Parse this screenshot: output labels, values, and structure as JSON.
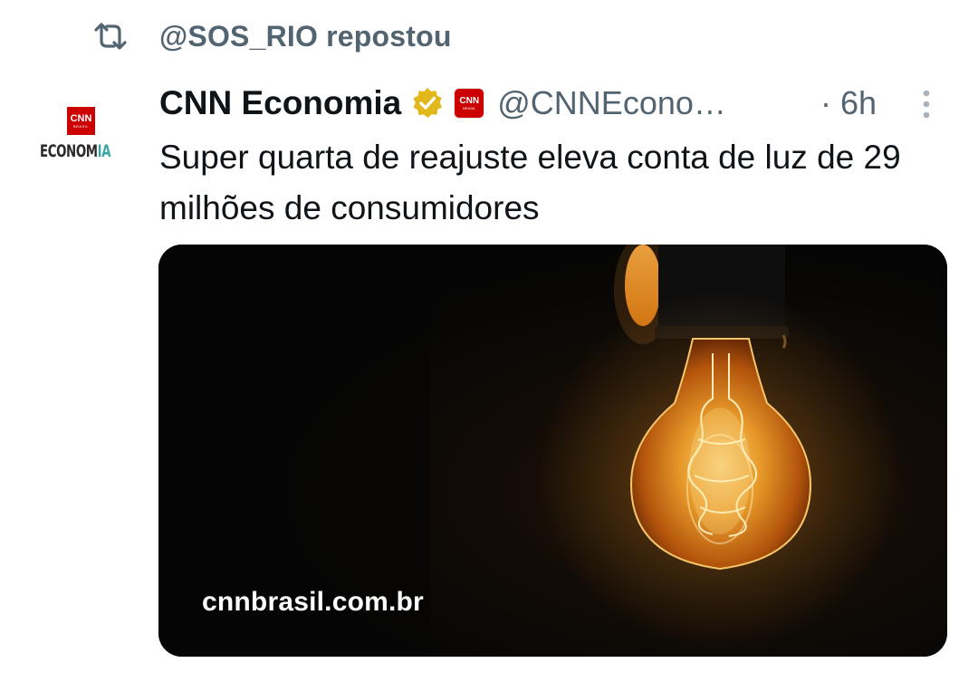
{
  "repost": {
    "text": "@SOS_RIO repostou",
    "icon": "repost-icon"
  },
  "author": {
    "name": "CNN Economia",
    "handle": "@CNNEcono…",
    "separator": "·",
    "time": "6h",
    "verified_icon": "verified-badge-icon",
    "affiliate_badge": {
      "label": "CNN",
      "sub": "BRASIL"
    },
    "avatar": {
      "cnn_label": "CNN",
      "cnn_sub": "BRASIL",
      "text_main": "ECONOM",
      "text_accent": "IA"
    }
  },
  "tweet": {
    "text": "Super quarta de reajuste eleva conta de luz de 29 milhões de consumidores"
  },
  "card": {
    "domain": "cnnbrasil.com.br",
    "image_subject": "glowing incandescent light bulb on dark background"
  },
  "colors": {
    "secondary_text": "#536471",
    "primary_text": "#0f1419",
    "verified_gold": "#e2b719",
    "cnn_red": "#cc0000",
    "avatar_accent": "#3aa4a4"
  }
}
